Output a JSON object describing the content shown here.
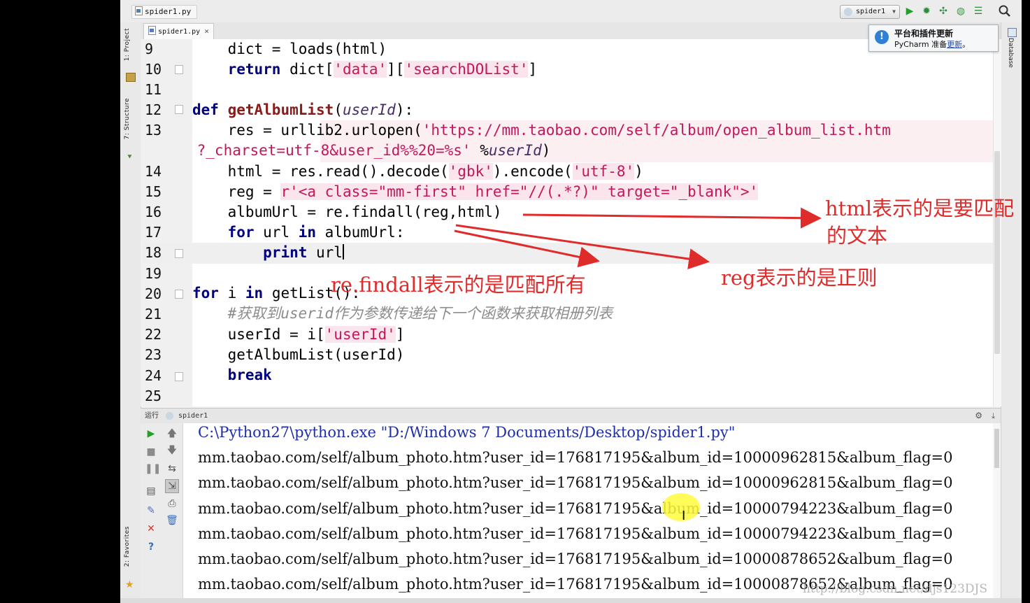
{
  "breadcrumb": {
    "file": "spider1.py"
  },
  "run_config": {
    "name": "spider1"
  },
  "editor_tab": {
    "label": "spider1.py",
    "close": "×"
  },
  "left_tabs": {
    "project": "1: Project",
    "structure": "7: Structure",
    "favorites": "2: Favorites"
  },
  "right_tabs": {
    "database": "Database"
  },
  "notification": {
    "title": "平台和插件更新",
    "body_prefix": "PyCharm 准备",
    "link": "更新",
    "body_suffix": "。"
  },
  "line_numbers": [
    "9",
    "10",
    "11",
    "12",
    "13",
    "",
    "14",
    "15",
    "16",
    "17",
    "18",
    "19",
    "20",
    "21",
    "22",
    "23",
    "24",
    "25"
  ],
  "code": {
    "l9": {
      "text": "    dict = loads(html)"
    },
    "l10": {
      "kw": "return",
      "pre": " dict[",
      "s1": "'data'",
      "mid": "][",
      "s2": "'searchDOList'",
      "post": "]"
    },
    "l12": {
      "kw": "def",
      "sp": " ",
      "fn": "getAlbumList",
      "open": "(",
      "param": "userId",
      "close": "):"
    },
    "l13": {
      "pre": "    res = urllib2.urlopen(",
      "s": "'https://mm.taobao.com/self/album/open_album_list.htm"
    },
    "l13b": {
      "s": " ?_charset=utf-8&user_id%%20=%s'",
      "mid": " %",
      "param": "userId",
      "post": ")"
    },
    "l14": {
      "pre": "    html = res.read().decode(",
      "s1": "'gbk'",
      "mid": ").encode(",
      "s2": "'utf-8'",
      "post": ")"
    },
    "l15": {
      "pre": "    reg = ",
      "s": "r'<a class=\"mm-first\" href=\"//(.*?)\" target=\"_blank\">'"
    },
    "l16": {
      "text": "    albumUrl = re.findall(reg,html)"
    },
    "l17": {
      "kw": "for",
      "mid1": " url ",
      "kw2": "in",
      "post": " albumUrl:"
    },
    "l18": {
      "kw": "print",
      "post": " url"
    },
    "l20": {
      "kw": "for",
      "mid1": " i ",
      "kw2": "in",
      "post": " getList():"
    },
    "l21": {
      "comment": "#获取到userid作为参数传递给下一个函数来获取相册列表"
    },
    "l22": {
      "pre": "    userId = i[",
      "s": "'userId'",
      "post": "]"
    },
    "l23": {
      "text": "    getAlbumList(userId)"
    },
    "l24": {
      "kw": "break"
    }
  },
  "annotations": {
    "html_line1": "html表示的是要匹配",
    "html_line2": "的文本",
    "reg": "reg表示的是正则",
    "findall": "re.findall表示的是匹配所有"
  },
  "run_panel": {
    "label": "运行",
    "config": "spider1",
    "command": "C:\\Python27\\python.exe \"D:/Windows 7 Documents/Desktop/spider1.py\"",
    "output": [
      "mm.taobao.com/self/album_photo.htm?user_id=176817195&album_id=10000962815&album_flag=0",
      "mm.taobao.com/self/album_photo.htm?user_id=176817195&album_id=10000962815&album_flag=0",
      "mm.taobao.com/self/album_photo.htm?user_id=176817195&album_id=10000794223&album_flag=0",
      "mm.taobao.com/self/album_photo.htm?user_id=176817195&album_id=10000794223&album_flag=0",
      "mm.taobao.com/self/album_photo.htm?user_id=176817195&album_id=10000878652&album_flag=0",
      "mm.taobao.com/self/album_photo.htm?user_id=176817195&album_id=10000878652&album_flag=0"
    ]
  },
  "watermark": "http://blog.csdn.net/djs123DJS",
  "colors": {
    "annotation": "#e02b2b",
    "keyword": "#000080",
    "string": "#c2185b",
    "run_green": "#22a12a"
  }
}
